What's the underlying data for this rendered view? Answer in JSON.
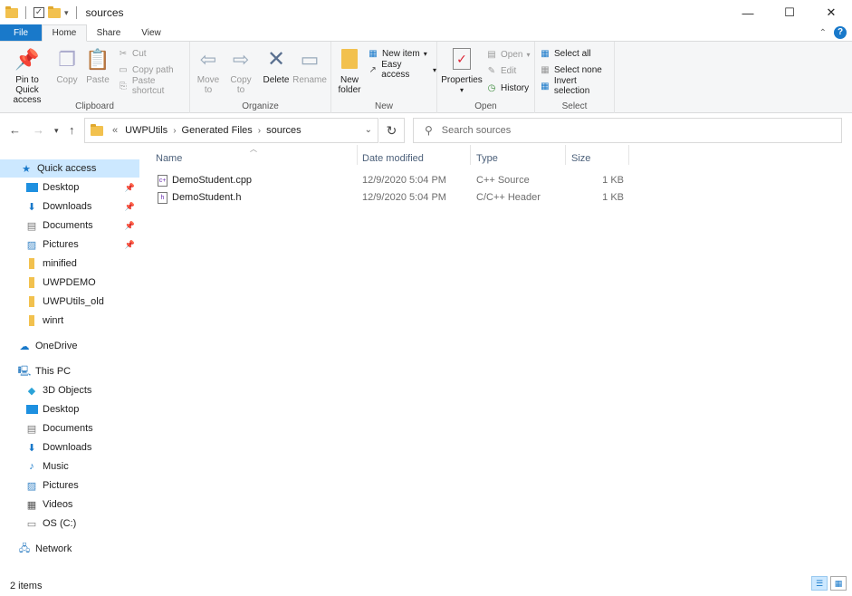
{
  "window": {
    "title": "sources",
    "controls": {
      "minimize": "—",
      "maximize": "☐",
      "close": "✕"
    }
  },
  "ribbon_tabs": {
    "file": "File",
    "home": "Home",
    "share": "Share",
    "view": "View"
  },
  "ribbon": {
    "clipboard": {
      "label": "Clipboard",
      "pin": "Pin to Quick access",
      "copy": "Copy",
      "paste": "Paste",
      "cut": "Cut",
      "copy_path": "Copy path",
      "paste_shortcut": "Paste shortcut"
    },
    "organize": {
      "label": "Organize",
      "move_to": "Move to",
      "copy_to": "Copy to",
      "delete": "Delete",
      "rename": "Rename"
    },
    "new": {
      "label": "New",
      "new_folder": "New folder",
      "new_item": "New item",
      "easy_access": "Easy access"
    },
    "open": {
      "label": "Open",
      "properties": "Properties",
      "open": "Open",
      "edit": "Edit",
      "history": "History"
    },
    "select": {
      "label": "Select",
      "select_all": "Select all",
      "select_none": "Select none",
      "invert": "Invert selection"
    }
  },
  "address": {
    "overflow": "«",
    "crumbs": [
      "UWPUtils",
      "Generated Files",
      "sources"
    ],
    "search_placeholder": "Search sources"
  },
  "nav": {
    "quick_access": "Quick access",
    "quick_items": [
      "Desktop",
      "Downloads",
      "Documents",
      "Pictures",
      "minified",
      "UWPDEMO",
      "UWPUtils_old",
      "winrt"
    ],
    "onedrive": "OneDrive",
    "this_pc": "This PC",
    "pc_items": [
      "3D Objects",
      "Desktop",
      "Documents",
      "Downloads",
      "Music",
      "Pictures",
      "Videos",
      "OS (C:)"
    ],
    "network": "Network"
  },
  "columns": {
    "name": "Name",
    "date": "Date modified",
    "type": "Type",
    "size": "Size"
  },
  "files": [
    {
      "name": "DemoStudent.cpp",
      "date": "12/9/2020 5:04 PM",
      "type": "C++ Source",
      "size": "1 KB"
    },
    {
      "name": "DemoStudent.h",
      "date": "12/9/2020 5:04 PM",
      "type": "C/C++ Header",
      "size": "1 KB"
    }
  ],
  "status": {
    "count": "2 items"
  },
  "colors": {
    "accent": "#1979ca",
    "selection": "#cce8ff",
    "folder": "#f2c14e"
  }
}
